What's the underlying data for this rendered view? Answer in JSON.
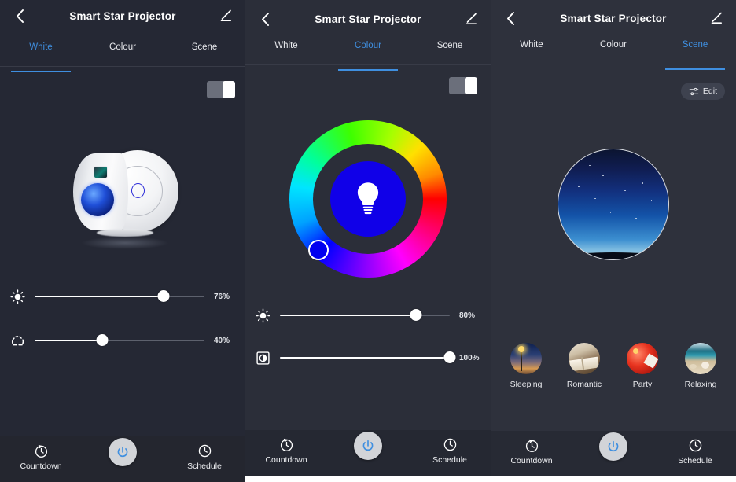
{
  "app": {
    "title": "Smart Star Projector",
    "accent": "#3f8fe0",
    "background": "#2b2e39"
  },
  "icons": {
    "back": "chevron-left-icon",
    "edit_pencil": "pencil-icon",
    "brightness": "brightness-icon",
    "color_temperature": "color-temperature-icon",
    "saturation": "saturation-icon",
    "bulb": "light-bulb-icon",
    "edit_sliders": "sliders-icon",
    "countdown": "countdown-timer-icon",
    "schedule": "clock-schedule-icon",
    "power": "power-icon"
  },
  "tabs": [
    {
      "label": "White"
    },
    {
      "label": "Colour"
    },
    {
      "label": "Scene"
    }
  ],
  "bottom_nav": {
    "countdown_label": "Countdown",
    "schedule_label": "Schedule",
    "power_label": "Power"
  },
  "panels": [
    {
      "id": "white-panel",
      "active_tab": "White",
      "power_toggle": {
        "state": "on"
      },
      "device_image_alt": "Smart star projector device",
      "sliders": [
        {
          "name": "brightness",
          "icon": "brightness-icon",
          "value": 76,
          "display": "76%"
        },
        {
          "name": "color-temperature",
          "icon": "color-temperature-icon",
          "value": 40,
          "display": "40%"
        }
      ]
    },
    {
      "id": "colour-panel",
      "active_tab": "Colour",
      "power_toggle": {
        "state": "on"
      },
      "color_wheel": {
        "selected_color": "#0000f0",
        "selected_angle_deg": 225,
        "center_color": "#1000e8",
        "center_icon": "light-bulb-icon"
      },
      "sliders": [
        {
          "name": "brightness",
          "icon": "brightness-icon",
          "value": 80,
          "display": "80%"
        },
        {
          "name": "saturation",
          "icon": "saturation-icon",
          "value": 100,
          "display": "100%"
        }
      ]
    },
    {
      "id": "scene-panel",
      "active_tab": "Scene",
      "edit_button_label": "Edit",
      "preview_alt": "Starry night sky scene preview",
      "scenes": [
        {
          "label": "Sleeping",
          "thumb": "th-sleeping"
        },
        {
          "label": "Romantic",
          "thumb": "th-romantic"
        },
        {
          "label": "Party",
          "thumb": "th-party"
        },
        {
          "label": "Relaxing",
          "thumb": "th-relaxing"
        }
      ]
    }
  ]
}
